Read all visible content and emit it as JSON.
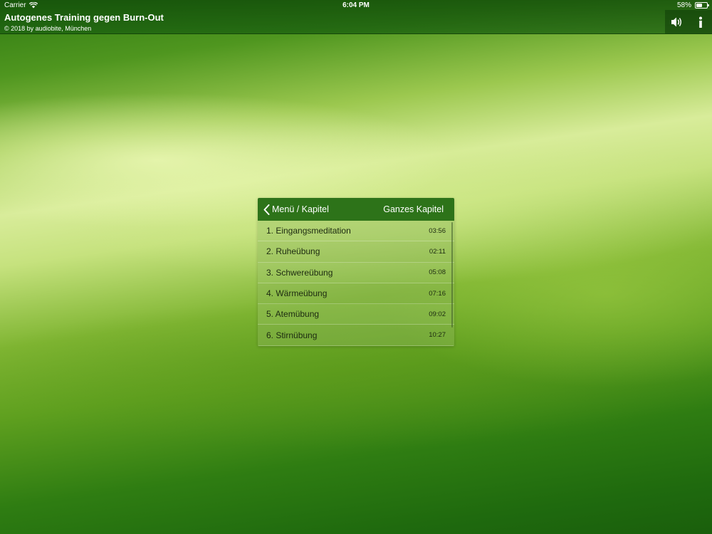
{
  "status_bar": {
    "carrier": "Carrier",
    "time": "6:04 PM",
    "battery": "58%",
    "battery_level": 0.58
  },
  "header": {
    "title": "Autogenes Training gegen Burn-Out",
    "subtitle": "© 2018 by audiobite, München",
    "buttons": [
      "speaker-icon",
      "info-icon"
    ]
  },
  "panel": {
    "back_label": "Menü / Kapitel",
    "action_label": "Ganzes Kapitel",
    "items": [
      {
        "label": "1. Eingangsmeditation",
        "duration": "03:56"
      },
      {
        "label": "2. Ruheübung",
        "duration": "02:11"
      },
      {
        "label": "3. Schwereübung",
        "duration": "05:08"
      },
      {
        "label": "4. Wärmeübung",
        "duration": "07:16"
      },
      {
        "label": "5. Atemübung",
        "duration": "09:02"
      },
      {
        "label": "6. Stirnübung",
        "duration": "10:27"
      }
    ]
  },
  "colors": {
    "accent": "#2d7319"
  }
}
